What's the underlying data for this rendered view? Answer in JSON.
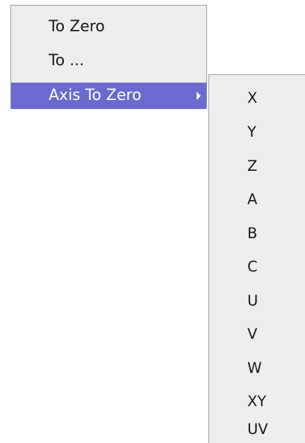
{
  "menu": {
    "items": [
      {
        "label": "To Zero"
      },
      {
        "label": "To ..."
      },
      {
        "label": "Axis To Zero",
        "has_submenu": true,
        "highlighted": true
      }
    ]
  },
  "submenu": {
    "items": [
      {
        "label": "X"
      },
      {
        "label": "Y"
      },
      {
        "label": "Z"
      },
      {
        "label": "A"
      },
      {
        "label": "B"
      },
      {
        "label": "C"
      },
      {
        "label": "U"
      },
      {
        "label": "V"
      },
      {
        "label": "W"
      },
      {
        "label": "XY"
      },
      {
        "label": "UV"
      }
    ]
  },
  "colors": {
    "menu_background": "#ededed",
    "highlight": "#6a6ad0",
    "border": "#9a9a9a"
  }
}
